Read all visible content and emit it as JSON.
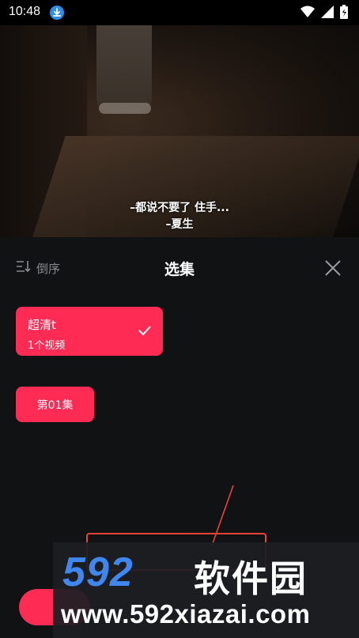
{
  "status": {
    "time": "10:48"
  },
  "video": {
    "subtitle_line1": "–都说不要了 住手...",
    "subtitle_line2": "–夏生"
  },
  "panel": {
    "sort_label": "倒序",
    "title": "选集",
    "quality": {
      "name": "超清t",
      "count": "1个视频",
      "selected": true
    },
    "episodes": [
      {
        "label": "第01集"
      }
    ]
  },
  "watermark": {
    "logo": "592",
    "cn": "软件园",
    "url": "www.592xiazai.com"
  },
  "colors": {
    "accent": "#fe2c55",
    "background": "#111214",
    "watermark_blue": "#3f86ef",
    "annotation_red": "#e8443a"
  }
}
